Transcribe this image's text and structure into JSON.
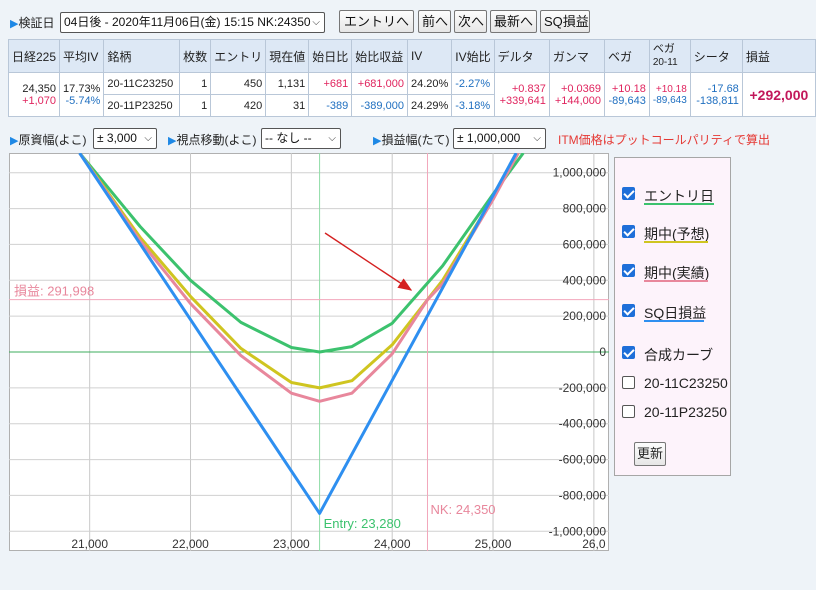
{
  "topbar": {
    "kenshou_label": "検証日",
    "date_select": "04日後 - 2020年11月06日(金) 15:15 NK:24350",
    "buttons": [
      "エントリへ",
      "前へ",
      "次へ",
      "最新へ",
      "SQ損益"
    ]
  },
  "table": {
    "headers": [
      "日経225",
      "平均IV",
      "銘柄",
      "枚数",
      "エントリ",
      "現在値",
      "始日比",
      "始比収益",
      "IV",
      "IV始比",
      "デルタ",
      "ガンマ",
      "ベガ",
      "ベガ",
      "シータ",
      "損益"
    ],
    "vega_sub": "20-11",
    "nikkei": "24,350",
    "nikkei_change": "+1,070",
    "avg_iv": "17.73%",
    "avg_iv_change": "-5.74%",
    "rows": [
      {
        "symbol": "20-11C23250",
        "qty": "1",
        "entry": "450",
        "current": "1,131",
        "day_change": "+681",
        "profit": "+681,000",
        "iv": "24.20%",
        "iv_change": "-2.27%",
        "delta": "+0.837",
        "gamma": "+0.0369",
        "vega": "+10.18"
      },
      {
        "symbol": "20-11P23250",
        "qty": "1",
        "entry": "420",
        "current": "31",
        "day_change": "-389",
        "profit": "-389,000",
        "iv": "24.29%",
        "iv_change": "-3.18%",
        "delta": "+339,641",
        "gamma": "+144,000",
        "vega": "-89,643"
      }
    ],
    "vega_total": [
      "+10.18",
      "-89,643"
    ],
    "theta": [
      "-17.68",
      "-138,811"
    ],
    "pnl_total": "+292,000"
  },
  "controls": {
    "range_label": "原資幅(よこ)",
    "range_value": "± 3,000",
    "view_label": "視点移動(よこ)",
    "view_value": "-- なし --",
    "pnl_label": "損益幅(たて)",
    "pnl_value": "± 1,000,000",
    "note": "ITM価格はプットコールパリティで算出"
  },
  "legend": {
    "items": [
      {
        "label": "エントリ日",
        "checked": true,
        "color": "#3cc26e"
      },
      {
        "label": "期中(予想)",
        "checked": true,
        "color": "#cfc520"
      },
      {
        "label": "期中(実績)",
        "checked": true,
        "color": "#e8879c"
      },
      {
        "label": "SQ日損益",
        "checked": true,
        "color": "#2e8ff0"
      },
      {
        "label": "合成カーブ",
        "checked": true,
        "color": ""
      },
      {
        "label": "20-11C23250",
        "checked": false,
        "color": ""
      },
      {
        "label": "20-11P23250",
        "checked": false,
        "color": ""
      }
    ],
    "update_label": "更新"
  },
  "chart_data": {
    "type": "line",
    "x_ticks": [
      "21,000",
      "22,000",
      "23,000",
      "24,000",
      "25,000",
      "26,0"
    ],
    "y_ticks": [
      "1,000,000",
      "800,000",
      "600,000",
      "400,000",
      "200,000",
      "0",
      "-200,000",
      "-400,000",
      "-600,000",
      "-800,000",
      "-1,000,000"
    ],
    "xlim": [
      20200,
      26150
    ],
    "ylim": [
      -1110000,
      1110000
    ],
    "entry_label": "Entry: 23,280",
    "entry_x": 23280,
    "nk_label": "NK: 24,350",
    "nk_x": 24350,
    "pnl_label": "損益: 291,998",
    "pnl_y": 291998,
    "grid": true,
    "series": [
      {
        "name": "エントリ日",
        "color": "#3cc26e",
        "x": [
          20900,
          21500,
          22000,
          22500,
          23000,
          23280,
          23600,
          24000,
          24500,
          25000,
          25300
        ],
        "y": [
          1110000,
          700000,
          400000,
          165000,
          25000,
          0,
          30000,
          160000,
          480000,
          880000,
          1110000
        ]
      },
      {
        "name": "期中(予想)",
        "color": "#cfc520",
        "x": [
          20900,
          21500,
          22000,
          22500,
          23000,
          23280,
          23600,
          24000,
          24500,
          25000,
          25250
        ],
        "y": [
          1110000,
          640000,
          310000,
          20000,
          -170000,
          -200000,
          -160000,
          40000,
          400000,
          860000,
          1110000
        ]
      },
      {
        "name": "期中(実績)",
        "color": "#e8879c",
        "x": [
          20900,
          21500,
          22000,
          22500,
          23000,
          23280,
          23600,
          24000,
          24350,
          24500,
          25000,
          25250
        ],
        "y": [
          1110000,
          620000,
          270000,
          -20000,
          -230000,
          -275000,
          -230000,
          -10000,
          291998,
          380000,
          850000,
          1110000
        ]
      },
      {
        "name": "SQ日損益",
        "color": "#2e8ff0",
        "x": [
          20900,
          23280,
          25230
        ],
        "y": [
          1110000,
          -900000,
          1110000
        ]
      }
    ]
  }
}
